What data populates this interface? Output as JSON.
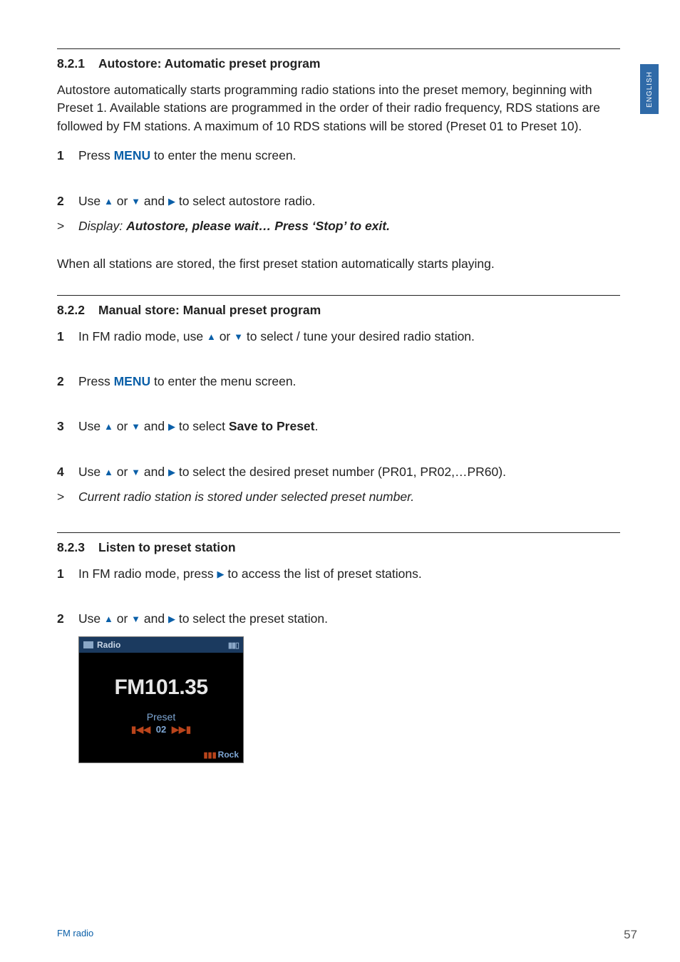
{
  "sideTab": "ENGLISH",
  "s821": {
    "num": "8.2.1",
    "title": "Autostore:  Automatic preset program",
    "intro": "Autostore automatically starts programming radio stations into the preset memory, beginning with Preset 1. Available stations are programmed in the order of their radio frequency, RDS stations are followed by FM stations. A maximum of 10 RDS stations will be stored (Preset 01 to Preset 10).",
    "step1_a": "Press ",
    "step1_menu": "MENU",
    "step1_b": " to enter the menu screen.",
    "step2_a": "Use ",
    "step2_b": " or ",
    "step2_c": " and ",
    "step2_d": " to select autostore radio.",
    "result_a": "Display: ",
    "result_b": "Autostore",
    "result_c": ", please wait…  Press ‘Stop’ to exit.",
    "after": "When all stations are stored, the first preset station automatically starts playing."
  },
  "s822": {
    "num": "8.2.2",
    "title": "Manual store: Manual preset program",
    "step1_a": "In FM radio mode, use ",
    "step1_b": " or ",
    "step1_c": " to select / tune your desired radio station.",
    "step2_a": "Press ",
    "step2_menu": "MENU",
    "step2_b": " to enter the menu screen.",
    "step3_a": "Use ",
    "step3_b": " or ",
    "step3_c": " and ",
    "step3_d": " to select ",
    "step3_bold": "Save to Preset",
    "step3_e": ".",
    "step4_a": "Use ",
    "step4_b": " or ",
    "step4_c": " and ",
    "step4_d": " to select the desired preset number (PR01, PR02,…PR60).",
    "result": "Current radio station is stored under selected preset number."
  },
  "s823": {
    "num": "8.2.3",
    "title": "Listen to preset station",
    "step1_a": "In FM radio mode, press  ",
    "step1_b": " to access the list of preset stations.",
    "step2_a": "Use ",
    "step2_b": " or ",
    "step2_c": " and ",
    "step2_d": " to select the preset station."
  },
  "device": {
    "headLabel": "Radio",
    "freq": "FM101.35",
    "presetLabel": "Preset",
    "presetNum": "02",
    "genre": "Rock"
  },
  "footer": {
    "section": "FM radio",
    "page": "57"
  },
  "marks": {
    "n1": "1",
    "n2": "2",
    "n3": "3",
    "n4": "4",
    "gt": ">"
  }
}
